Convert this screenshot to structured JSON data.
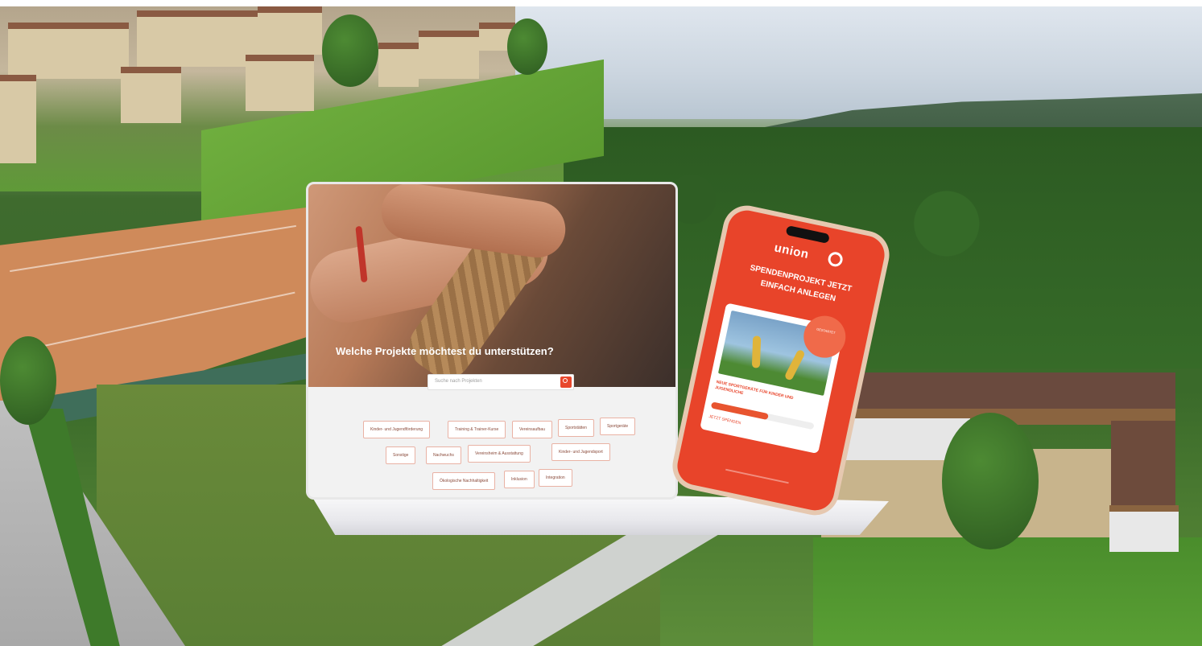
{
  "laptop": {
    "hero_title": "Welche Projekte möchtest du unterstützen?",
    "search_placeholder": "Suche nach Projekten",
    "tags": [
      "Kinder- und Jugendförderung",
      "Training & Trainer-Kurse",
      "Vereinsaufbau",
      "Sportstätten",
      "Sportgeräte",
      "Sonstige",
      "Nachwuchs",
      "Vereinsheim & Ausstattung",
      "Kinder- und Jugendsport",
      "Ökologische Nachhaltigkeit",
      "Inklusion",
      "Integration"
    ]
  },
  "phone": {
    "logo": "union",
    "headline": "SPENDENPROJEKT JETZT EINFACH ANLEGEN",
    "badge": "GESTARTET",
    "card_text": "NEUE SPORTGERÄTE FÜR KINDER UND JUGENDLICHE",
    "card_link": "JETZT SPENDEN",
    "progress": 0.55
  },
  "colors": {
    "accent": "#e8442a",
    "court": "#cf8a5a",
    "grass": "#4a8d2c"
  }
}
